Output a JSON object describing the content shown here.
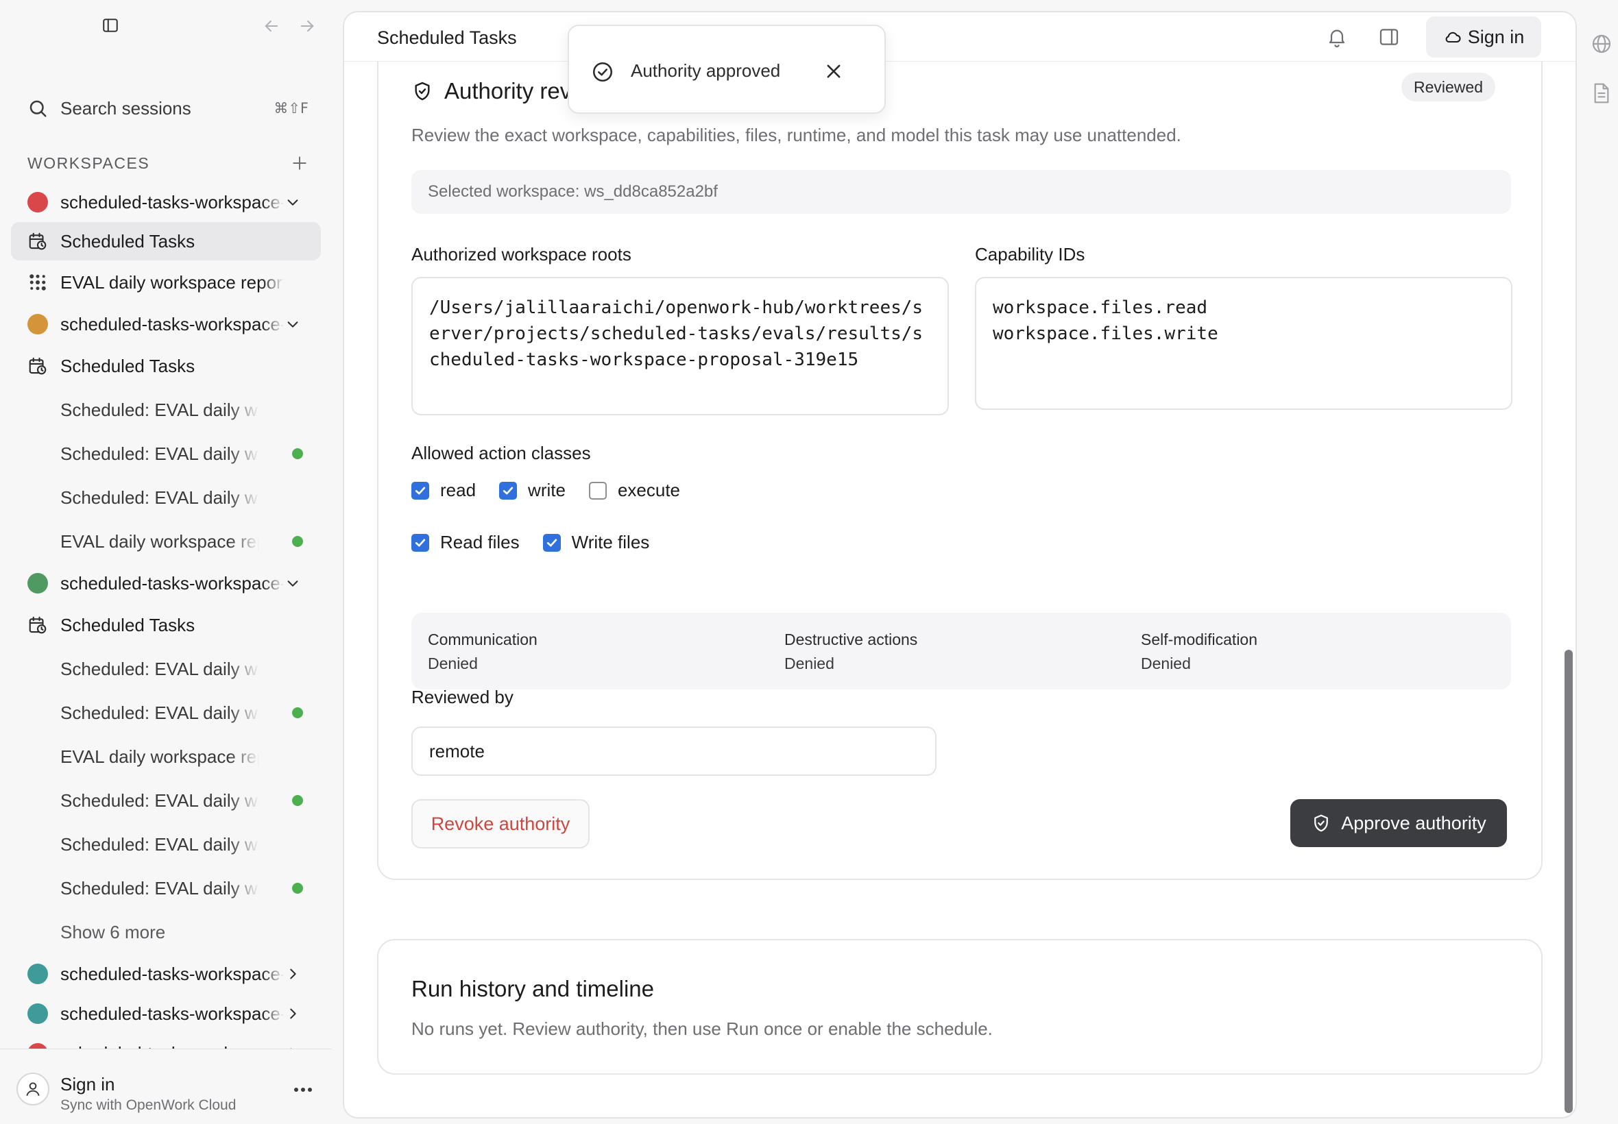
{
  "sidebar": {
    "search": {
      "label": "Search sessions",
      "shortcut": "⌘⇧F"
    },
    "workspaces_title": "WORKSPACES",
    "items": [
      {
        "kind": "workspace",
        "label": "scheduled-tasks-workspace-proposal",
        "color": "#d9474a",
        "chevron": "down"
      },
      {
        "kind": "tasks",
        "label": "Scheduled Tasks",
        "active": true
      },
      {
        "kind": "app",
        "label": "EVAL daily workspace report"
      },
      {
        "kind": "workspace",
        "label": "scheduled-tasks-workspace-proposal",
        "color": "#d4953a",
        "chevron": "down"
      },
      {
        "kind": "tasks",
        "label": "Scheduled Tasks"
      },
      {
        "kind": "session",
        "label": "Scheduled: EVAL daily workspace report"
      },
      {
        "kind": "session",
        "label": "Scheduled: EVAL daily workspace report",
        "status": true
      },
      {
        "kind": "session",
        "label": "Scheduled: EVAL daily workspace report"
      },
      {
        "kind": "session",
        "label": "EVAL daily workspace report",
        "status": true
      },
      {
        "kind": "workspace",
        "label": "scheduled-tasks-workspace-proposal",
        "color": "#4f9a63",
        "chevron": "down"
      },
      {
        "kind": "tasks",
        "label": "Scheduled Tasks"
      },
      {
        "kind": "session",
        "label": "Scheduled: EVAL daily workspace report"
      },
      {
        "kind": "session",
        "label": "Scheduled: EVAL daily workspace report",
        "status": true
      },
      {
        "kind": "session",
        "label": "EVAL daily workspace report"
      },
      {
        "kind": "session",
        "label": "Scheduled: EVAL daily workspace report",
        "status": true
      },
      {
        "kind": "session",
        "label": "Scheduled: EVAL daily workspace report"
      },
      {
        "kind": "session",
        "label": "Scheduled: EVAL daily workspace report",
        "status": true
      },
      {
        "kind": "more",
        "label": "Show 6 more"
      },
      {
        "kind": "workspace",
        "label": "scheduled-tasks-workspace-proposal",
        "color": "#3f9a9a",
        "chevron": "right"
      },
      {
        "kind": "workspace",
        "label": "scheduled-tasks-workspace-proposal",
        "color": "#3f9a9a",
        "chevron": "right"
      },
      {
        "kind": "workspace",
        "label": "scheduled-tasks-workspace-proposal",
        "color": "#d9474a",
        "chevron": "right"
      }
    ],
    "footer": {
      "name": "Sign in",
      "subtitle": "Sync with OpenWork Cloud"
    }
  },
  "topbar": {
    "title": "Scheduled Tasks",
    "signin_label": "Sign in"
  },
  "toast": {
    "message": "Authority approved"
  },
  "authority": {
    "title": "Authority review",
    "badge": "Reviewed",
    "description": "Review the exact workspace, capabilities, files, runtime, and model this task may use unattended.",
    "selected_workspace": "Selected workspace: ws_dd8ca852a2bf",
    "roots_label": "Authorized workspace roots",
    "roots_value": "/Users/jalillaaraichi/openwork-hub/worktrees/server/projects/scheduled-tasks/evals/results/scheduled-tasks-workspace-proposal-319e15",
    "capabilities_label": "Capability IDs",
    "capabilities_value": "workspace.files.read\nworkspace.files.write",
    "action_classes_label": "Allowed action classes",
    "action_classes": [
      {
        "label": "read",
        "checked": true
      },
      {
        "label": "write",
        "checked": true
      },
      {
        "label": "execute",
        "checked": false
      }
    ],
    "file_permissions": [
      {
        "label": "Read files",
        "checked": true
      },
      {
        "label": "Write files",
        "checked": true
      }
    ],
    "denied": [
      {
        "name": "Communication",
        "value": "Denied"
      },
      {
        "name": "Destructive actions",
        "value": "Denied"
      },
      {
        "name": "Self-modification",
        "value": "Denied"
      }
    ],
    "reviewed_by_label": "Reviewed by",
    "reviewed_by_value": "remote",
    "revoke_label": "Revoke authority",
    "approve_label": "Approve authority"
  },
  "history": {
    "title": "Run history and timeline",
    "description": "No runs yet. Review authority, then use Run once or enable the schedule."
  },
  "colors": {
    "accent": "#2f6fde",
    "danger": "#d0453d",
    "status_green": "#4caf50",
    "dark_button": "#3c3d40"
  }
}
